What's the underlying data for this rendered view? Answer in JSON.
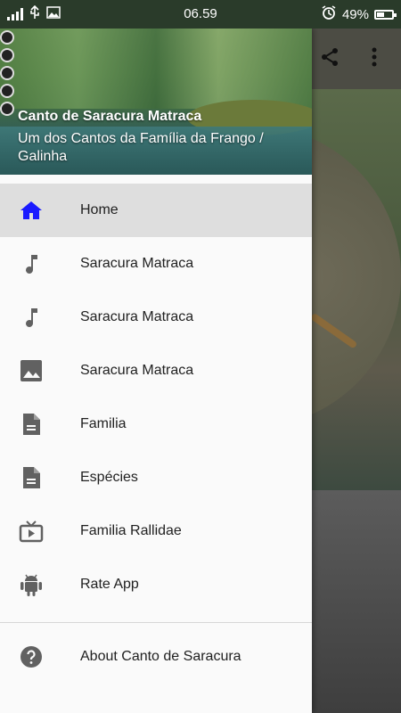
{
  "status_bar": {
    "time": "06.59",
    "battery_percent": "49%",
    "battery_level": 0.49,
    "icons": [
      "signal-icon",
      "usb-icon",
      "image-icon",
      "alarm-icon",
      "battery-icon"
    ]
  },
  "toolbar": {
    "icons": [
      "share-icon",
      "more-vert-icon"
    ]
  },
  "drawer": {
    "header": {
      "title": "Canto de Saracura Matraca",
      "subtitle": "Um dos Cantos da Família da Frango / Galinha"
    },
    "items": [
      {
        "label": "Home",
        "icon": "home-icon",
        "selected": true,
        "color": "#1a1aff"
      },
      {
        "label": "Saracura Matraca",
        "icon": "music-note-icon"
      },
      {
        "label": "Saracura Matraca",
        "icon": "music-note-icon"
      },
      {
        "label": "Saracura Matraca",
        "icon": "image-icon"
      },
      {
        "label": "Familia",
        "icon": "document-icon"
      },
      {
        "label": "Espécies",
        "icon": "document-icon"
      },
      {
        "label": "Familia Rallidae",
        "icon": "tv-icon"
      },
      {
        "label": "Rate App",
        "icon": "android-icon"
      }
    ],
    "footer_item": {
      "label": "About Canto de Saracura",
      "icon": "help-icon"
    }
  }
}
